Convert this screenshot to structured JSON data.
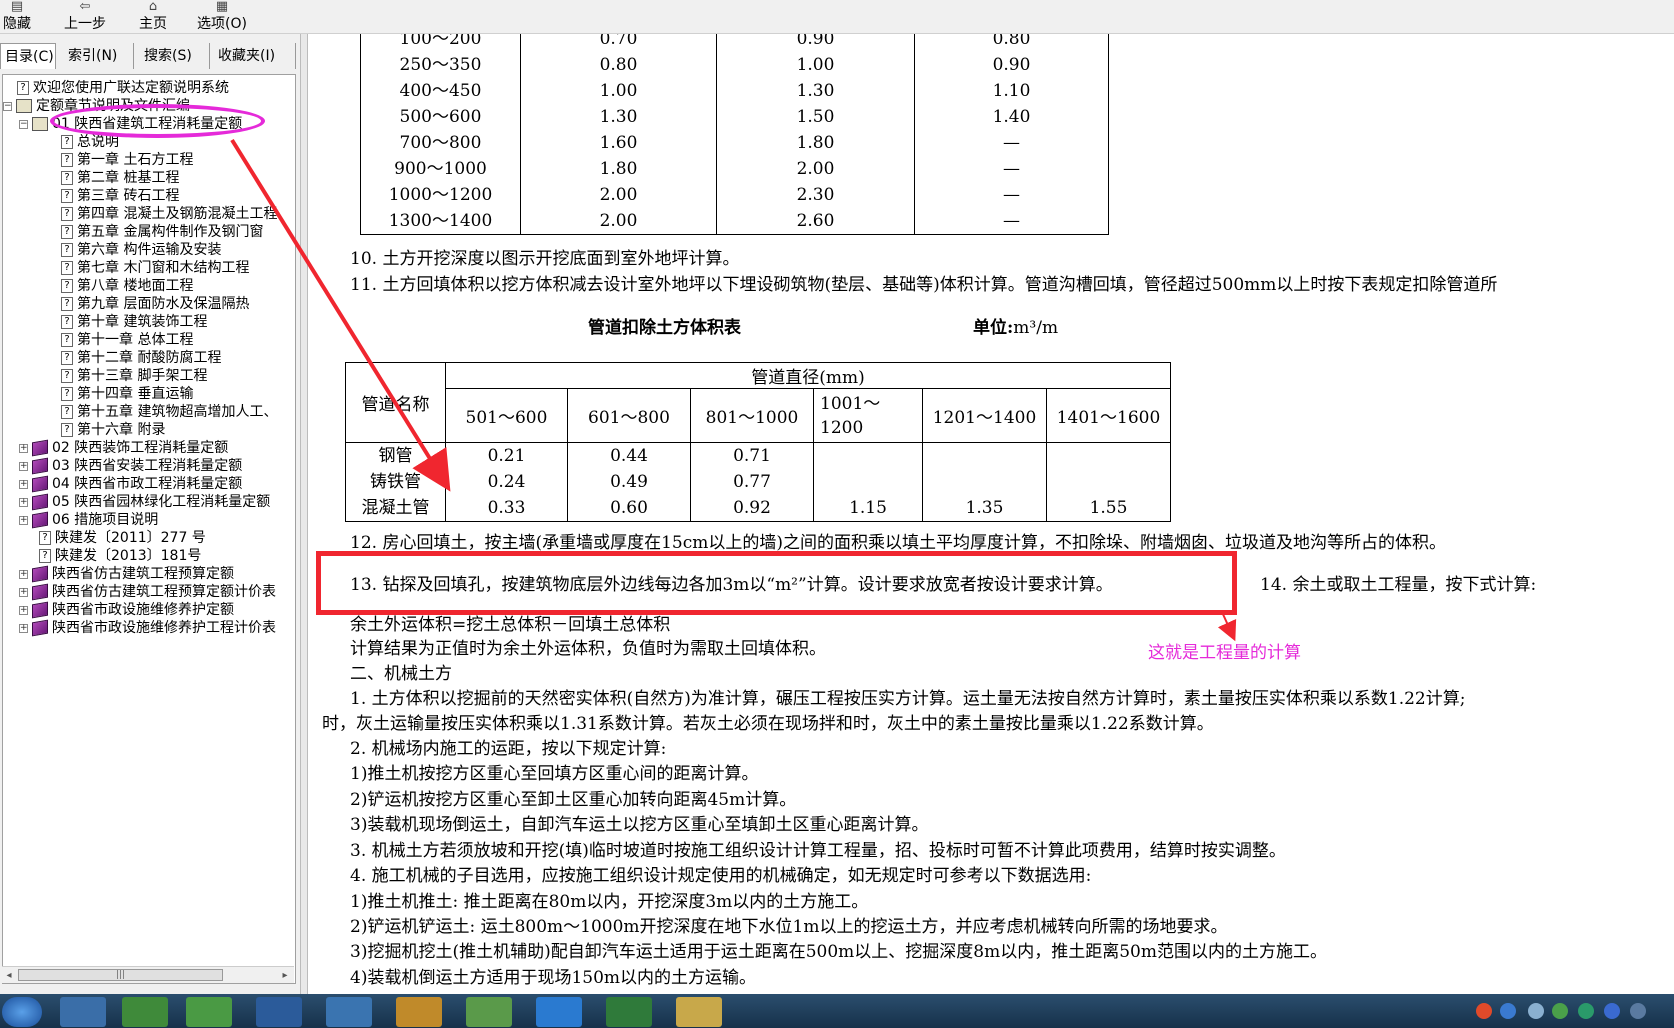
{
  "toolbar": {
    "hide": "隐藏",
    "back": "上一步",
    "home": "主页",
    "options": "选项(O)"
  },
  "tabs": [
    "目录(C)",
    "索引(N)",
    "搜索(S)",
    "收藏夹(I)"
  ],
  "tree": {
    "welcome": "欢迎您使用广联达定额说明系统",
    "root": "定额章节说明及文件汇编",
    "node01": "01 陕西省建筑工程消耗量定额",
    "overview": "总说明",
    "chapters": [
      "第一章 土石方工程",
      "第二章 桩基工程",
      "第三章 砖石工程",
      "第四章 混凝土及钢筋混凝土工程",
      "第五章 金属构件制作及钢门窗",
      "第六章 构件运输及安装",
      "第七章 木门窗和木结构工程",
      "第八章 楼地面工程",
      "第九章 层面防水及保温隔热",
      "第十章 建筑装饰工程",
      "第十一章 总体工程",
      "第十二章 耐酸防腐工程",
      "第十三章 脚手架工程",
      "第十四章 垂直运输",
      "第十五章 建筑物超高增加人工、",
      "第十六章 附录"
    ],
    "nodes": [
      "02 陕西装饰工程消耗量定额",
      "03 陕西省安装工程消耗量定额",
      "04 陕西省市政工程消耗量定额",
      "05 陕西省园林绿化工程消耗量定额",
      "06 措施项目说明"
    ],
    "docs": [
      "陕建发〔2011〕277 号",
      "陕建发〔2013〕181号"
    ],
    "more": [
      "陕西省仿古建筑工程预算定额",
      "陕西省仿古建筑工程预算定额计价表",
      "陕西省市政设施维修养护定额",
      "陕西省市政设施维修养护工程计价表"
    ]
  },
  "table1": {
    "rows": [
      [
        "100～200",
        "0.70",
        "0.90",
        "0.80"
      ],
      [
        "250～350",
        "0.80",
        "1.00",
        "0.90"
      ],
      [
        "400～450",
        "1.00",
        "1.30",
        "1.10"
      ],
      [
        "500～600",
        "1.30",
        "1.50",
        "1.40"
      ],
      [
        "700～800",
        "1.60",
        "1.80",
        "—"
      ],
      [
        "900～1000",
        "1.80",
        "2.00",
        "—"
      ],
      [
        "1000～1200",
        "2.00",
        "2.30",
        "—"
      ],
      [
        "1300～1400",
        "2.00",
        "2.60",
        "—"
      ]
    ]
  },
  "content": {
    "p10": "10. 土方开挖深度以图示开挖底面到室外地坪计算。",
    "p11": "11. 土方回填体积以挖方体积减去设计室外地坪以下埋设砌筑物(垫层、基础等)体积计算。管道沟槽回填，管径超过500mm以上时按下表规定扣除管道所",
    "table2_title": "管道扣除土方体积表",
    "table2_unit_prefix": "单位:",
    "table2_unit": "m³/m",
    "p12": "12. 房心回填土，按主墙(承重墙或厚度在15cm以上的墙)之间的面积乘以填土平均厚度计算，不扣除垛、附墙烟囱、垃圾道及地沟等所占的体积。",
    "p13": "13. 钻探及回填孔，按建筑物底层外边线每边各加3m以“m²”计算。设计要求放宽者按设计要求计算。",
    "p14": "14. 余土或取土工程量，按下式计算:",
    "p15": "余土外运体积=挖土总体积－回填土总体积",
    "p16": "计算结果为正值时为余土外运体积，负值时为需取土回填体积。",
    "s2": "二、机械土方",
    "m1a": "1. 土方体积以挖掘前的天然密实体积(自然方)为准计算，碾压工程按压实方计算。运土量无法按自然方计算时，素土量按压实体积乘以系数1.22计算;",
    "m1b": "时，灰土运输量按压实体积乘以1.31系数计算。若灰土必须在现场拌和时，灰土中的素土量按比量乘以1.22系数计算。",
    "m2": "2. 机械场内施工的运距，按以下规定计算:",
    "m2a": "1)推土机按挖方区重心至回填方区重心间的距离计算。",
    "m2b": "2)铲运机按挖方区重心至卸土区重心加转向距离45m计算。",
    "m2c": "3)装载机现场倒运土，自卸汽车运土以挖方区重心至填卸土区重心距离计算。",
    "m3": "3. 机械土方若须放坡和开挖(填)临时坡道时按施工组织设计计算工程量，招、投标时可暂不计算此项费用，结算时按实调整。",
    "m4": "4. 施工机械的子目选用，应按施工组织设计规定使用的机械确定，如无规定时可参考以下数据选用:",
    "m4a": "1)推土机推土: 推土距离在80m以内，开挖深度3m以内的土方施工。",
    "m4b": "2)铲运机铲运土: 运土800m～1000m开挖深度在地下水位1m以上的挖运土方，并应考虑机械转向所需的场地要求。",
    "m4c": "3)挖掘机挖土(推土机辅助)配自卸汽车运土适用于运土距离在500m以上、挖掘深度8m以内，推土距离50m范围以内的土方施工。",
    "m4d": "4)装载机倒运土方适用于现场150m以内的土方运输。"
  },
  "table2": {
    "header_name": "管道名称",
    "header_group": "管道直径(mm)",
    "columns": [
      "501～600",
      "601～800",
      "801～1000",
      "1001～\n1200",
      "1201～1400",
      "1401～1600"
    ],
    "row_names": [
      "钢管",
      "铸铁管",
      "混凝土管"
    ],
    "col1": [
      "0.21",
      "0.24",
      "0.33"
    ],
    "col2": [
      "0.44",
      "0.49",
      "0.60"
    ],
    "col3": [
      "0.71",
      "0.77",
      "0.92"
    ],
    "col4": "1.15",
    "col5": "1.35",
    "col6": "1.55"
  },
  "annotation": {
    "note": "这就是工程量的计算",
    "ellipse_color": "#e52ad9",
    "box_color": "#f0262f"
  }
}
